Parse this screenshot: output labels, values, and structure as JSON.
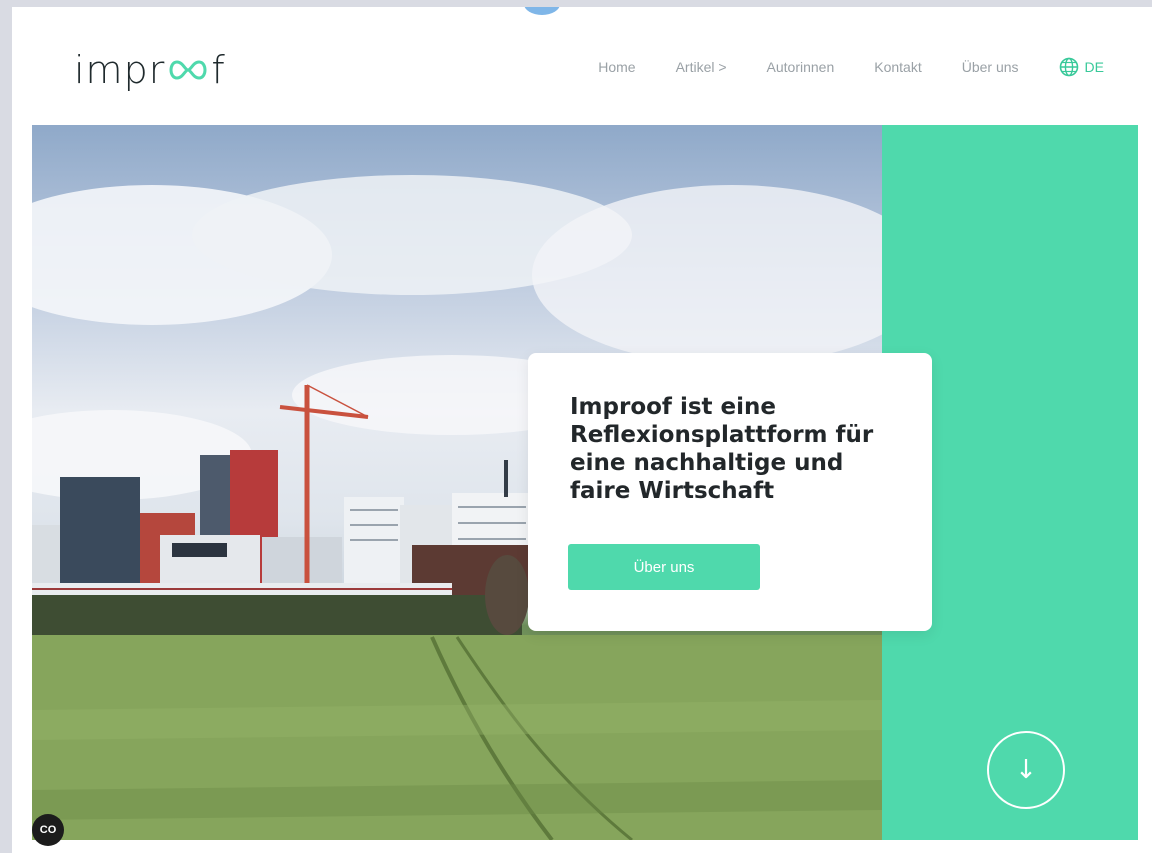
{
  "brand": {
    "logo_left": "impr",
    "logo_right": "f"
  },
  "nav": {
    "items": [
      {
        "label": "Home"
      },
      {
        "label": "Artikel >"
      },
      {
        "label": "Autorinnen"
      },
      {
        "label": "Kontakt"
      },
      {
        "label": "Über uns"
      }
    ],
    "language": "DE"
  },
  "hero": {
    "headline": "Improof ist eine Reflexionsplattform für eine nachhaltige und faire Wirtschaft",
    "cta_label": "Über uns",
    "scroll_icon": "arrow-down-icon"
  },
  "badge": {
    "label": "CO"
  },
  "colors": {
    "accent": "#4fd9ac",
    "text": "#22272a",
    "nav": "#9aa1a6"
  }
}
